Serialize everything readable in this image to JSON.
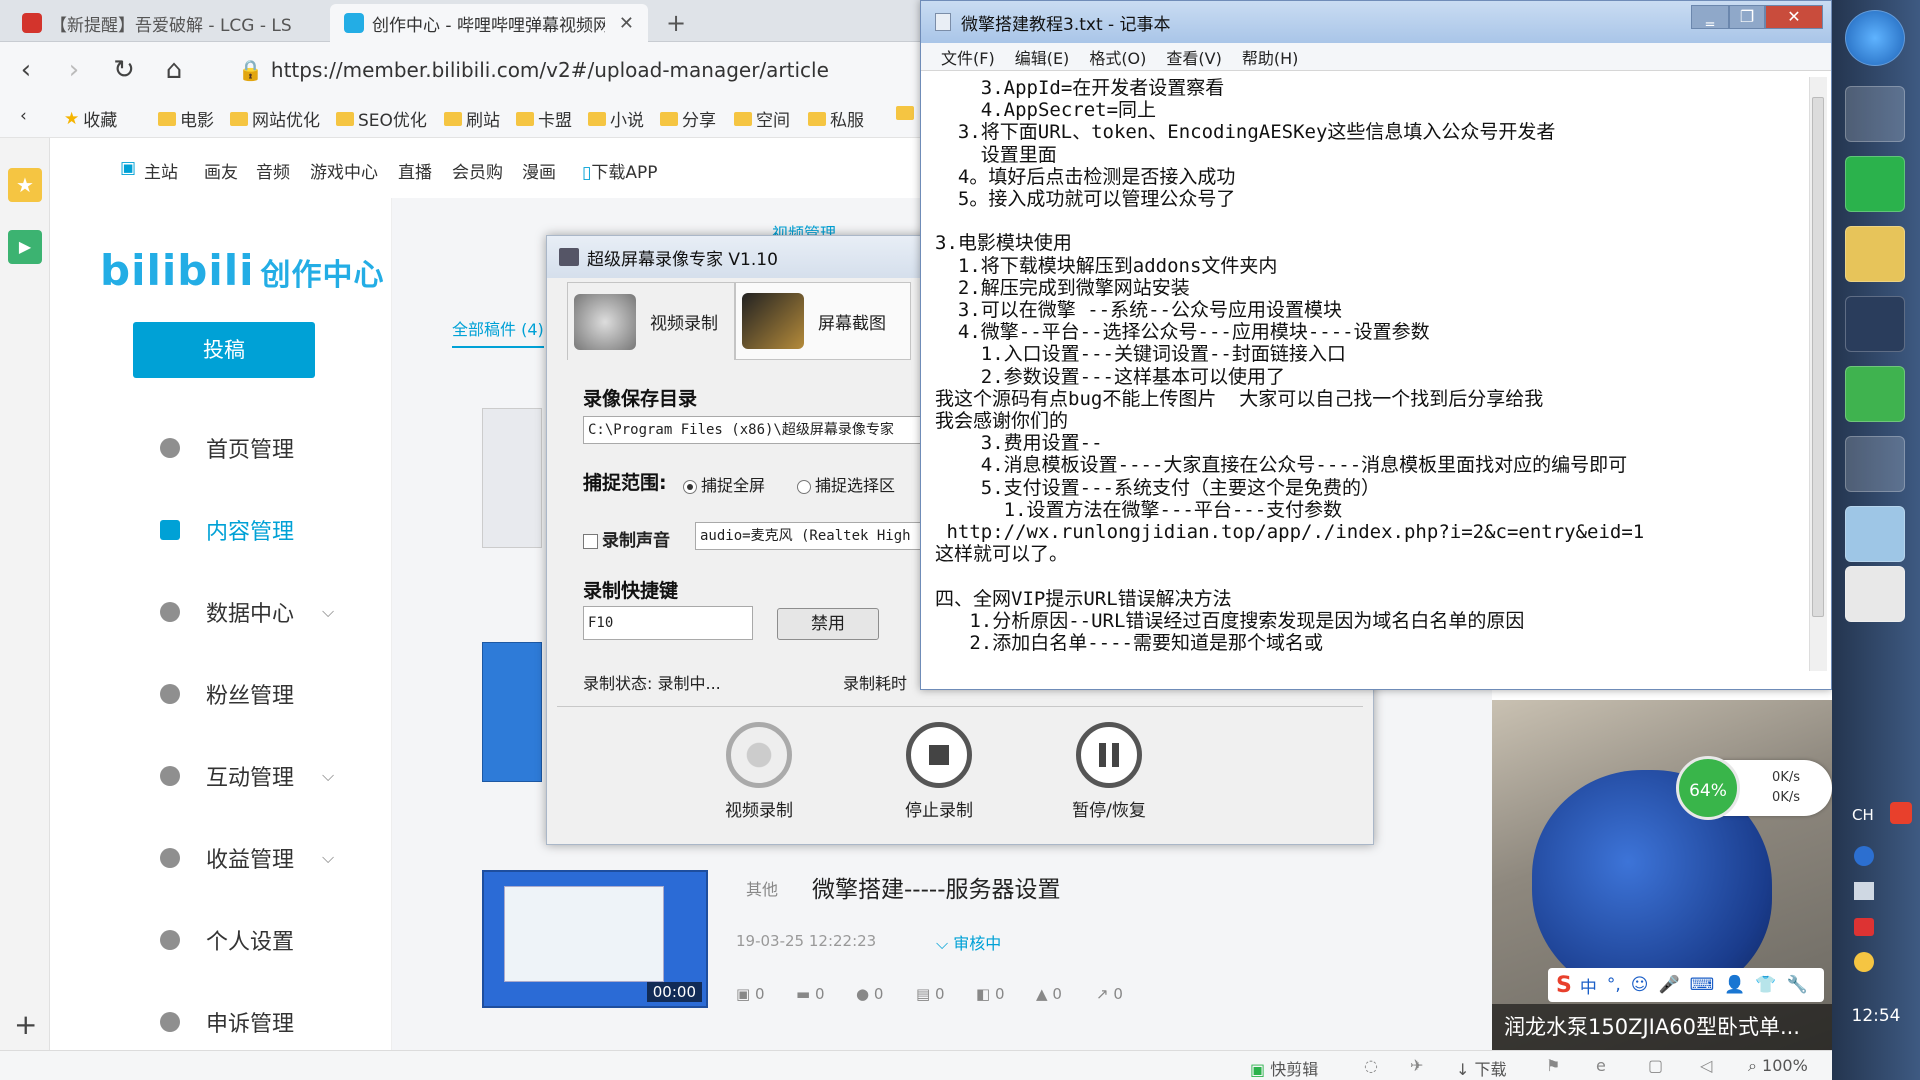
{
  "browser": {
    "tabs": [
      {
        "title": "【新提醒】吾爱破解 - LCG - LS",
        "active": false
      },
      {
        "title": "创作中心 - 哔哩哔哩弹幕视频网",
        "active": true
      }
    ],
    "url": "https://member.bilibili.com/v2#/upload-manager/article",
    "bookmarks": [
      "收藏",
      "电影",
      "网站优化",
      "SEO优化",
      "刷站",
      "卡盟",
      "小说",
      "分享",
      "空间",
      "私服",
      "↗"
    ],
    "icons": {
      "back": "‹",
      "forward": "›",
      "reload": "↻",
      "home": "⌂",
      "new_tab": "+",
      "close_tab": "✕"
    }
  },
  "bilibili": {
    "topnav": [
      "主站",
      "画友",
      "音频",
      "游戏中心",
      "直播",
      "会员购",
      "漫画",
      "下载APP"
    ],
    "logo": "bilibili",
    "logo_sub": "创作中心",
    "post_button": "投稿",
    "menu": [
      {
        "label": "首页管理",
        "active": false,
        "expand": false
      },
      {
        "label": "内容管理",
        "active": true,
        "expand": false
      },
      {
        "label": "数据中心",
        "active": false,
        "expand": true
      },
      {
        "label": "粉丝管理",
        "active": false,
        "expand": false
      },
      {
        "label": "互动管理",
        "active": false,
        "expand": true
      },
      {
        "label": "收益管理",
        "active": false,
        "expand": true
      },
      {
        "label": "个人设置",
        "active": false,
        "expand": false
      },
      {
        "label": "申诉管理",
        "active": false,
        "expand": false
      }
    ],
    "content_tab": "视频管理",
    "subtab": "全部稿件 (4)",
    "article": {
      "category": "其他",
      "title": "微擎搭建-----服务器设置",
      "date": "19-03-25 12:22:23",
      "status": "审核中",
      "duration": "00:00",
      "stats": [
        "0",
        "0",
        "0",
        "0",
        "0",
        "0",
        "0"
      ]
    },
    "accent": "#00a1d6"
  },
  "notepad": {
    "title": "微擎搭建教程3.txt - 记事本",
    "menu": [
      "文件(F)",
      "编辑(E)",
      "格式(O)",
      "查看(V)",
      "帮助(H)"
    ],
    "window_buttons": [
      "‗",
      "❐",
      "✕"
    ],
    "lines": [
      "    3.AppId=在开发者设置察看",
      "    4.AppSecret=同上",
      "  3.将下面URL、token、EncodingAESKey这些信息填入公众号开发者",
      "    设置里面",
      "  4。填好后点击检测是否接入成功",
      "  5。接入成功就可以管理公众号了",
      "",
      "3.电影模块使用",
      "  1.将下载模块解压到addons文件夹内",
      "  2.解压完成到微擎网站安装",
      "  3.可以在微擎 --系统--公众号应用设置模块",
      "  4.微擎--平台--选择公众号---应用模块----设置参数",
      "    1.入口设置---关键词设置--封面链接入口",
      "    2.参数设置---这样基本可以使用了",
      "我这个源码有点bug不能上传图片  大家可以自己找一个找到后分享给我",
      "我会感谢你们的",
      "    3.费用设置--",
      "    4.消息模板设置----大家直接在公众号----消息模板里面找对应的编号即可",
      "    5.支付设置---系统支付（主要这个是免费的）",
      "      1.设置方法在微擎---平台---支付参数",
      " http://wx.runlongjidian.top/app/./index.php?i=2&c=entry&eid=1",
      "这样就可以了。",
      "",
      "四、全网VIP提示URL错误解决方法",
      "   1.分析原因--URL错误经过百度搜索发现是因为域名白名单的原因",
      "   2.添加白名单----需要知道是那个域名或"
    ]
  },
  "recorder": {
    "title": "超级屏幕录像专家 V1.10",
    "tabs": [
      "视频录制",
      "屏幕截图"
    ],
    "save_dir_label": "录像保存目录",
    "save_dir": "C:\\Program Files (x86)\\超级屏幕录像专家",
    "capture_label": "捕捉范围:",
    "capture_full": "捕捉全屏",
    "capture_area": "捕捉选择区",
    "sound_label": "录制声音",
    "sound_device": "audio=麦克风 (Realtek High",
    "hotkey_label": "录制快捷键",
    "hotkey": "F10",
    "disable_button": "禁用",
    "status_label": "录制状态:",
    "status_value": "录制中...",
    "time_label": "录制耗时",
    "buttons": [
      "视频录制",
      "停止录制",
      "暂停/恢复"
    ]
  },
  "video": {
    "caption": "润龙水泵150ZJIA60型卧式单...",
    "net_percent": "64%",
    "net_up": "0K/s",
    "net_down": "0K/s",
    "ime": [
      "S",
      "中",
      "°,",
      "☺",
      "🎤",
      "⌨",
      "👤",
      "👕",
      "🔧"
    ]
  },
  "taskbar": {
    "lang": "CH",
    "time": "12:54"
  },
  "statusbar": {
    "items": [
      "快剪辑",
      "下载",
      "100%"
    ]
  }
}
